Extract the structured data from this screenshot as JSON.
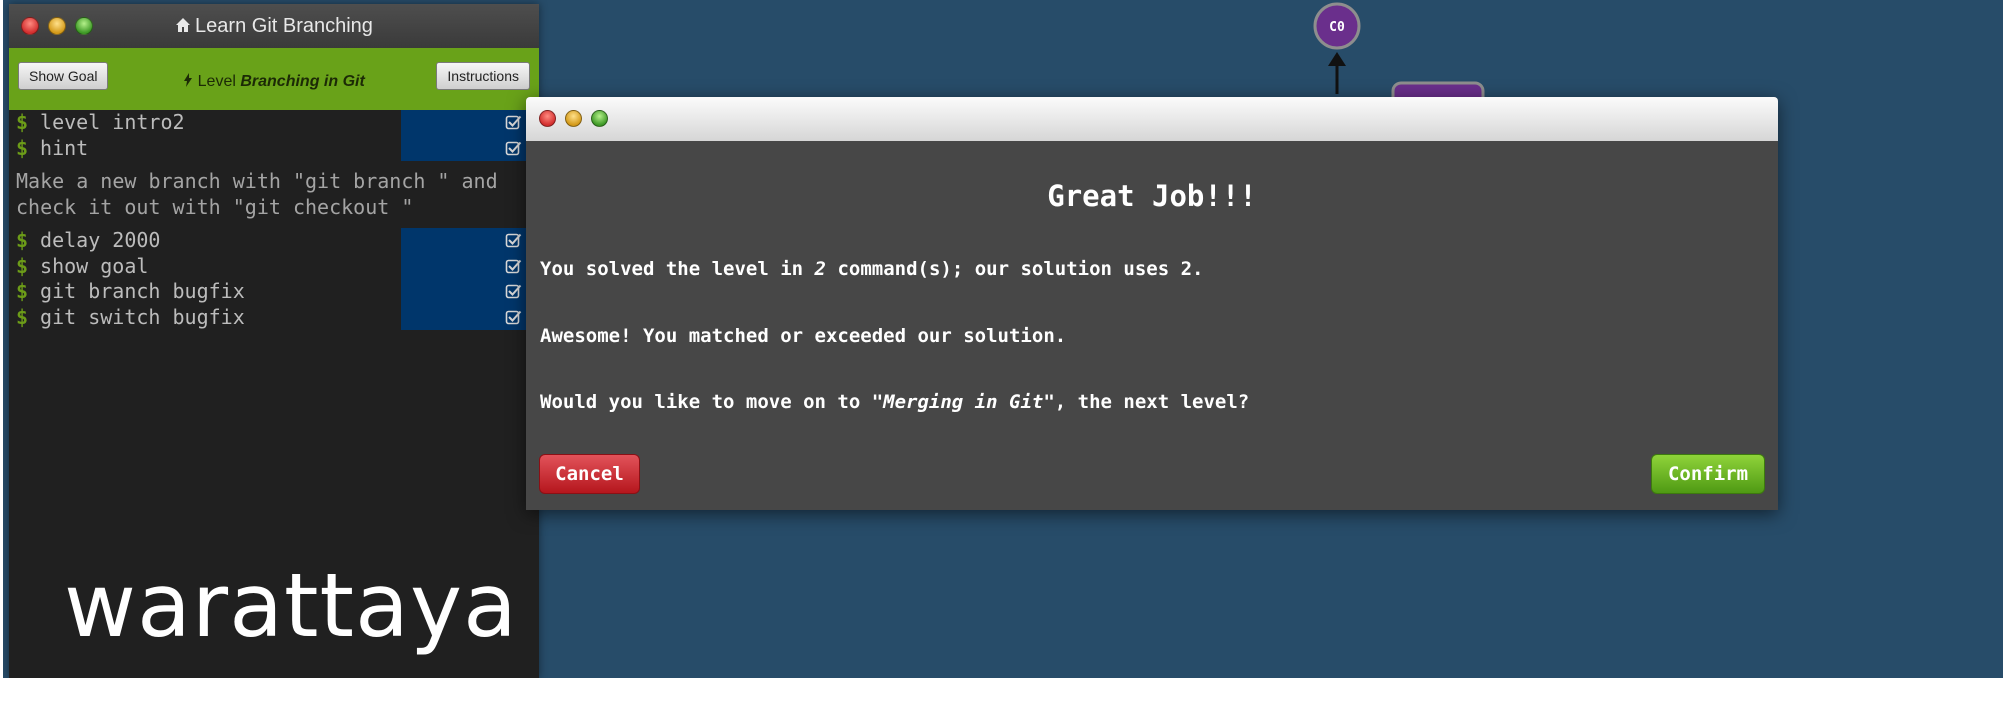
{
  "colors": {
    "background": "#274c69",
    "terminal_bg": "#202020",
    "level_bar": "#69a219",
    "highlight": "#00366b",
    "prompt": "#6c9c18",
    "node": "#6a2f8c",
    "cancel": "#c8262d",
    "confirm": "#6ab326"
  },
  "terminal": {
    "title": "Learn Git Branching",
    "title_icon": "home-icon",
    "show_goal_label": "Show Goal",
    "instructions_label": "Instructions",
    "level_prefix": "Level",
    "level_name": "Branching in Git",
    "level_icon": "bolt-icon",
    "prompt_symbol": "$",
    "commands_top": [
      {
        "text": "level intro2",
        "status_icon": "checkbox-checked-icon"
      },
      {
        "text": "hint",
        "status_icon": "checkbox-checked-icon"
      }
    ],
    "hint_text": "Make a new branch with \"git branch \" and\ncheck it out with \"git checkout \"",
    "commands_bottom": [
      {
        "text": "delay 2000",
        "status_icon": "checkbox-checked-icon"
      },
      {
        "text": "show goal",
        "status_icon": "checkbox-checked-icon"
      },
      {
        "text": "git branch bugfix",
        "status_icon": "checkbox-checked-icon"
      },
      {
        "text": "git switch bugfix",
        "status_icon": "checkbox-checked-icon"
      }
    ]
  },
  "watermark": "warattaya",
  "graph": {
    "nodes": [
      {
        "label": "C0"
      }
    ]
  },
  "modal": {
    "heading": "Great Job!!!",
    "line1_a": "You solved the level in ",
    "line1_count": "2",
    "line1_b": " command(s); our solution uses 2.",
    "line2": "Awesome! You matched or exceeded our solution.",
    "line3_a": "Would you like to move on to ",
    "line3_level": "\"Merging in Git\"",
    "line3_b": ", the next level?",
    "cancel_label": "Cancel",
    "confirm_label": "Confirm"
  }
}
